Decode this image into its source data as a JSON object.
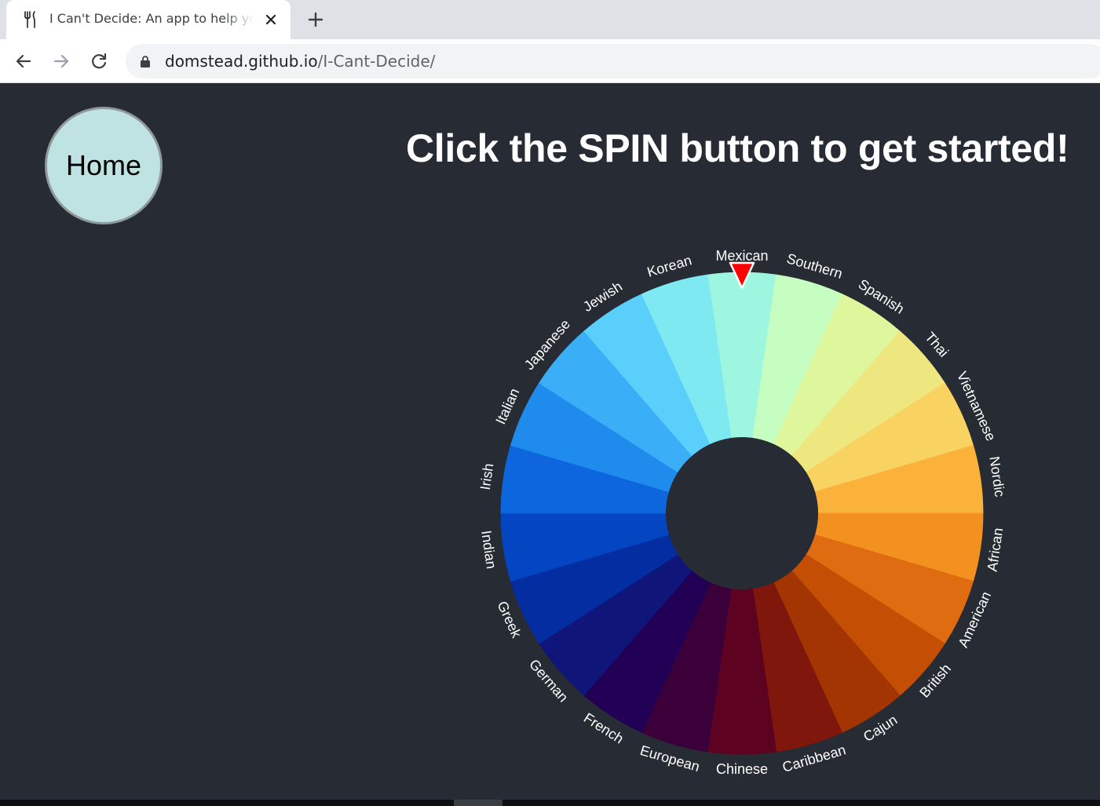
{
  "browser": {
    "tab_title": "I Can't Decide: An app to help you decide what to eat",
    "url_host": "domstead.github.io",
    "url_path": "/I-Cant-Decide/"
  },
  "page": {
    "home_label": "Home",
    "headline": "Click the SPIN button to get started!"
  },
  "wheel": {
    "pointer_color": "#ff0000",
    "segments": [
      {
        "label": "Mexican",
        "color": "#9ef5e0"
      },
      {
        "label": "Southern",
        "color": "#c6fdc0"
      },
      {
        "label": "Spanish",
        "color": "#dff79c"
      },
      {
        "label": "Thai",
        "color": "#eee780"
      },
      {
        "label": "Vietnamese",
        "color": "#f9d362"
      },
      {
        "label": "Nordic",
        "color": "#fbb23b"
      },
      {
        "label": "African",
        "color": "#f29120"
      },
      {
        "label": "American",
        "color": "#df6c10"
      },
      {
        "label": "British",
        "color": "#c44e04"
      },
      {
        "label": "Cajun",
        "color": "#a33502"
      },
      {
        "label": "Caribbean",
        "color": "#80170d"
      },
      {
        "label": "Chinese",
        "color": "#5d0321"
      },
      {
        "label": "European",
        "color": "#3b003a"
      },
      {
        "label": "French",
        "color": "#210056"
      },
      {
        "label": "German",
        "color": "#10157a"
      },
      {
        "label": "Greek",
        "color": "#032da0"
      },
      {
        "label": "Indian",
        "color": "#0445c2"
      },
      {
        "label": "Irish",
        "color": "#0d66de"
      },
      {
        "label": "Italian",
        "color": "#1f8ced"
      },
      {
        "label": "Japanese",
        "color": "#3aaff8"
      },
      {
        "label": "Jewish",
        "color": "#5bcffb"
      },
      {
        "label": "Korean",
        "color": "#7fe9f2"
      }
    ]
  }
}
